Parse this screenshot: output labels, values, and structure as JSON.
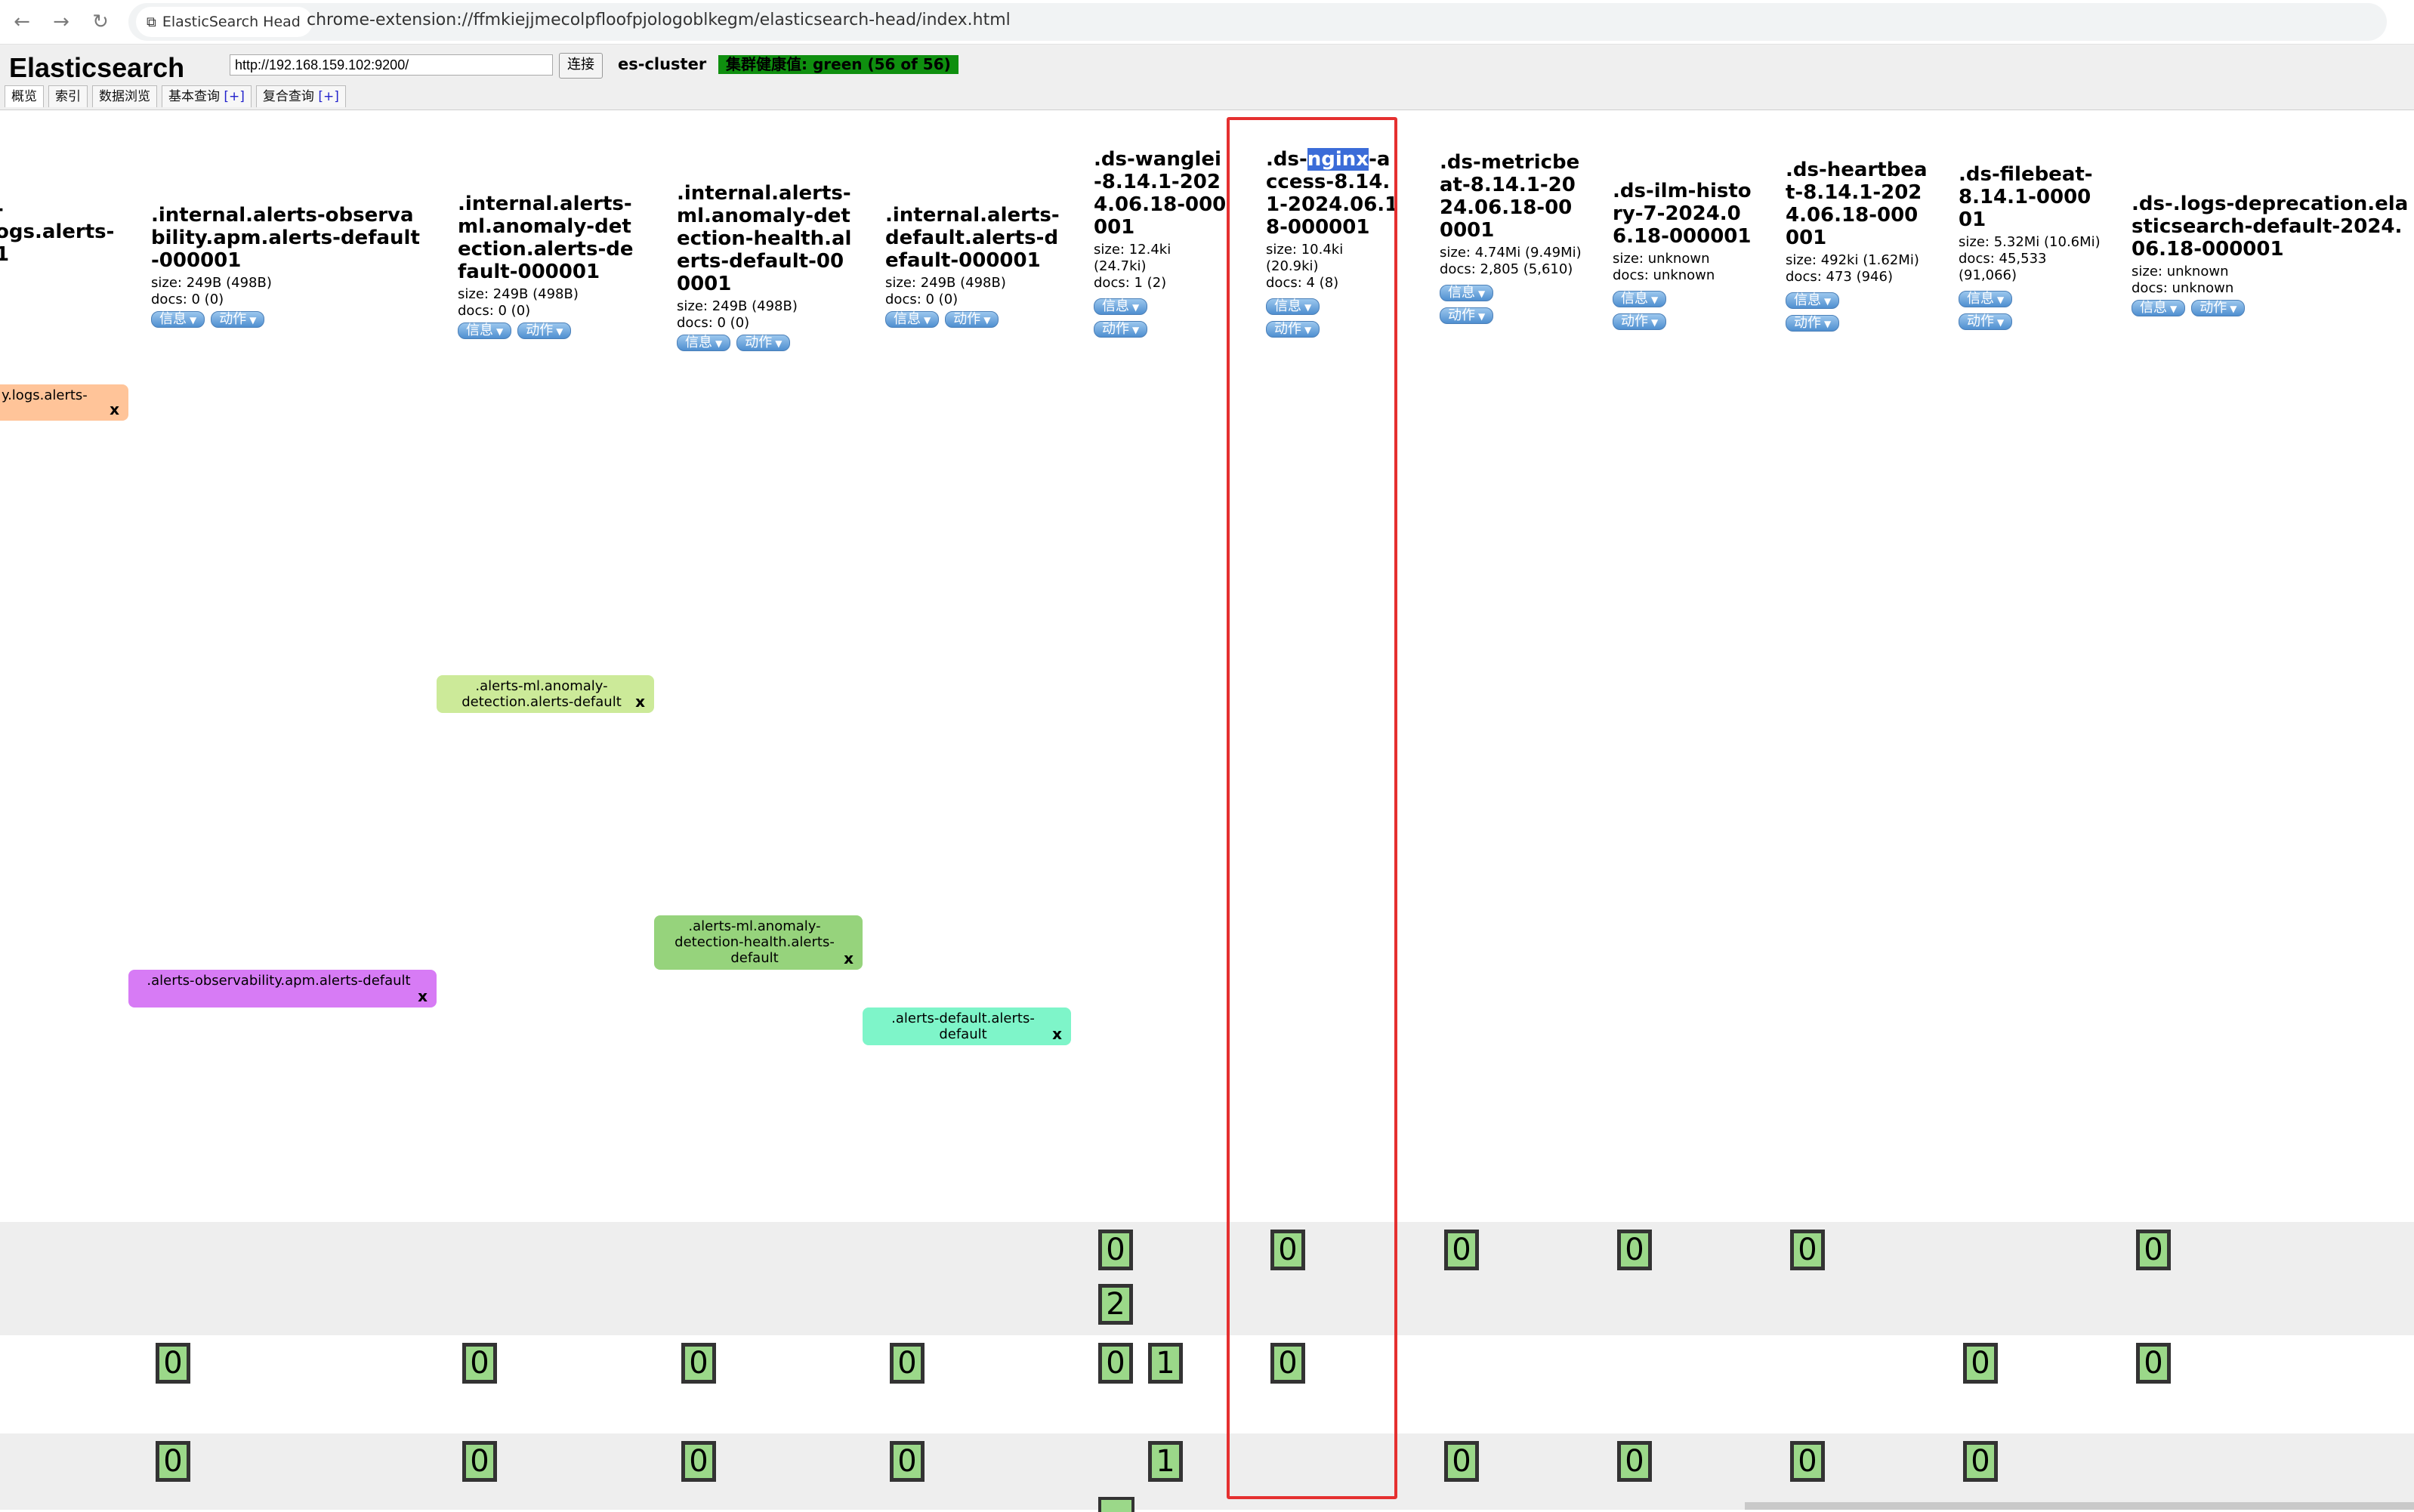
{
  "browser": {
    "tab_title": "ElasticSearch Head",
    "url": "chrome-extension://ffmkiejjmecolpfloofpjologoblkegm/elasticsearch-head/index.html",
    "icons": [
      "back-icon",
      "forward-icon",
      "reload-icon",
      "extension-icon"
    ]
  },
  "header": {
    "title": "Elasticsearch",
    "url_value": "http://192.168.159.102:9200/",
    "connect_label": "连接",
    "cluster_name": "es-cluster",
    "health": "集群健康值: green (56 of 56)",
    "health_color": "#0f8f0f",
    "tabs": [
      {
        "label": "概览",
        "plus": ""
      },
      {
        "label": "索引",
        "plus": ""
      },
      {
        "label": "数据浏览",
        "plus": ""
      },
      {
        "label": "基本查询",
        "plus": "[+]"
      },
      {
        "label": "复合查询",
        "plus": "[+]"
      }
    ]
  },
  "indices": [
    {
      "name": "-\nogs.alerts-\n1",
      "size": "",
      "docs": "",
      "has_info": false
    },
    {
      "name": ".internal.alerts-observability.apm.alerts-default-000001",
      "size": "size: 249B (498B)",
      "docs": "docs: 0 (0)",
      "has_info": true
    },
    {
      "name": ".internal.alerts-ml.anomaly-detection.alerts-default-000001",
      "size": "size: 249B (498B)",
      "docs": "docs: 0 (0)",
      "has_info": true
    },
    {
      "name": ".internal.alerts-ml.anomaly-detection-health.alerts-default-000001",
      "size": "size: 249B (498B)",
      "docs": "docs: 0 (0)",
      "has_info": true
    },
    {
      "name": ".internal.alerts-default.alerts-default-000001",
      "size": "size: 249B (498B)",
      "docs": "docs: 0 (0)",
      "has_info": true
    },
    {
      "name": ".ds-wanglei-8.14.1-2024.06.18-000001",
      "size": "size: 12.4ki (24.7ki)",
      "docs": "docs: 1 (2)",
      "has_info": true
    },
    {
      "name_pre": ".ds-",
      "name_hl": "nginx",
      "name_post": "-access-8.14.1-2024.06.18-000001",
      "size": "size: 10.4ki (20.9ki)",
      "docs": "docs: 4 (8)",
      "has_info": true
    },
    {
      "name": ".ds-metricbeat-8.14.1-2024.06.18-000001",
      "size": "size: 4.74Mi (9.49Mi)",
      "docs": "docs: 2,805 (5,610)",
      "has_info": true
    },
    {
      "name": ".ds-ilm-history-7-2024.06.18-000001",
      "size": "size: unknown",
      "docs": "docs: unknown",
      "has_info": true
    },
    {
      "name": ".ds-heartbeat-8.14.1-2024.06.18-000001",
      "size": "size: 492ki (1.62Mi)",
      "docs": "docs: 473 (946)",
      "has_info": true
    },
    {
      "name": ".ds-filebeat-8.14.1-000001",
      "size": "size: 5.32Mi (10.6Mi)",
      "docs": "docs: 45,533 (91,066)",
      "has_info": true
    },
    {
      "name": ".ds-.logs-deprecation.elasticsearch-default-2024.06.18-000001",
      "size": "size: unknown",
      "docs": "docs: unknown",
      "has_info": true
    }
  ],
  "buttons": {
    "info": "信息",
    "action": "动作"
  },
  "aliases": [
    {
      "label": "y.logs.alerts-",
      "color": "#ffc499"
    },
    {
      "label": ".alerts-ml.anomaly-detection.alerts-default",
      "color": "#ccea99"
    },
    {
      "label": ".alerts-ml.anomaly-detection-health.alerts-default",
      "color": "#96d37c"
    },
    {
      "label": ".alerts-observability.apm.alerts-default",
      "color": "#d77bf5"
    },
    {
      "label": ".alerts-default.alerts-default",
      "color": "#7ef5c9"
    }
  ],
  "alias_close": "x",
  "shards": {
    "row1": [
      "0",
      "2",
      "0",
      "0",
      "0",
      "0",
      "0"
    ],
    "row2": [
      "0",
      "0",
      "0",
      "0",
      "0",
      "1",
      "0",
      "0",
      "0"
    ],
    "row3": [
      "0",
      "0",
      "0",
      "0",
      "1",
      "0",
      "0",
      "0",
      "0"
    ]
  }
}
